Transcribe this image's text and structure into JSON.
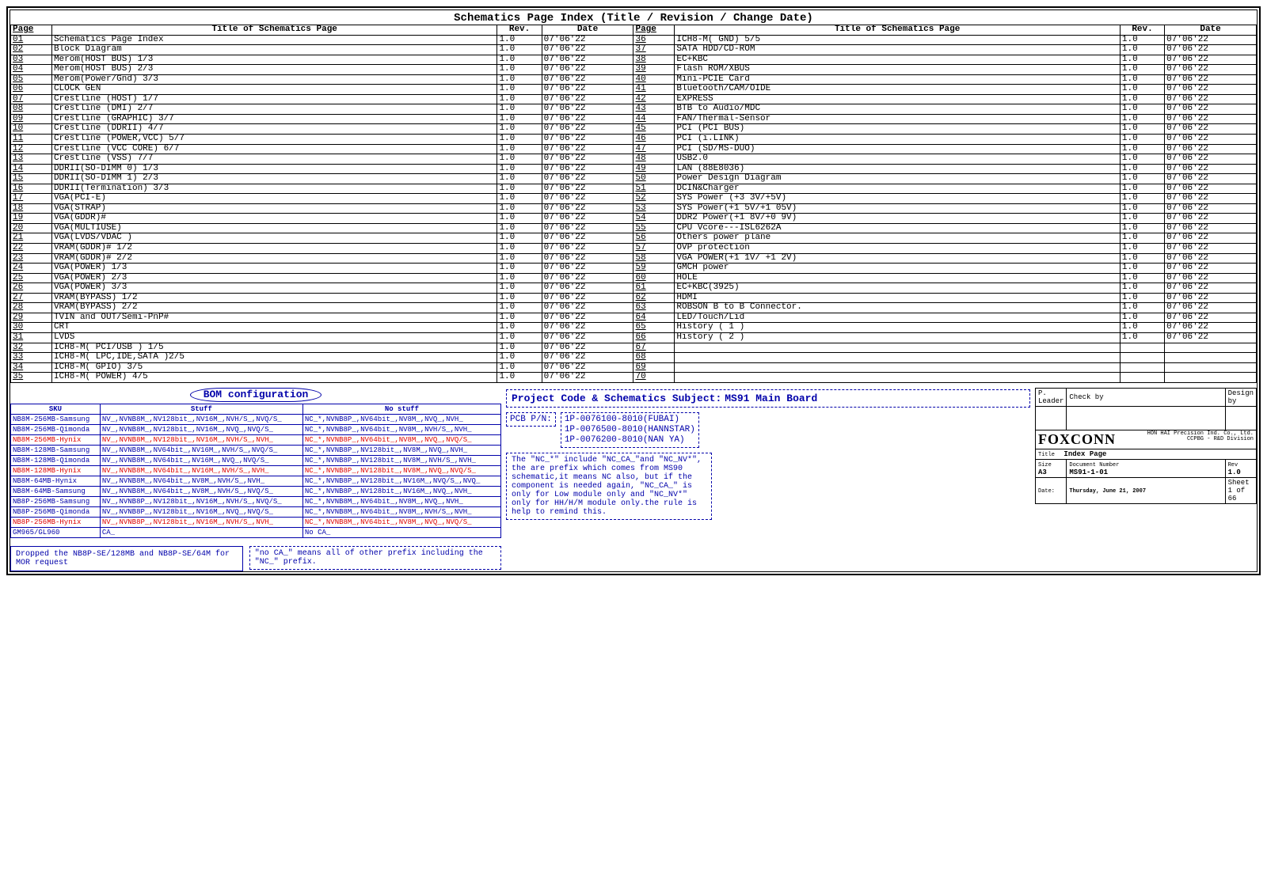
{
  "main_title": "Schematics Page Index (Title / Revision / Change Date)",
  "headers": {
    "page": "Page",
    "title": "Title of Schematics Page",
    "rev": "Rev.",
    "date": "Date"
  },
  "left_rows": [
    {
      "p": "01",
      "t": "Schematics Page Index",
      "r": "1.0",
      "d": "07'06'22"
    },
    {
      "p": "02",
      "t": "Block Diagram",
      "r": "1.0",
      "d": "07'06'22"
    },
    {
      "p": "03",
      "t": "Merom(HOST BUS) 1/3",
      "r": "1.0",
      "d": "07'06'22"
    },
    {
      "p": "04",
      "t": "Merom(HOST BUS) 2/3",
      "r": "1.0",
      "d": "07'06'22"
    },
    {
      "p": "05",
      "t": "Merom(Power/Gnd) 3/3",
      "r": "1.0",
      "d": "07'06'22"
    },
    {
      "p": "06",
      "t": "CLOCK GEN",
      "r": "1.0",
      "d": "07'06'22"
    },
    {
      "p": "07",
      "t": "Crestline (HOST) 1/7",
      "r": "1.0",
      "d": "07'06'22"
    },
    {
      "p": "08",
      "t": "Crestline (DMI) 2/7",
      "r": "1.0",
      "d": "07'06'22"
    },
    {
      "p": "09",
      "t": "Crestline (GRAPHIC) 3/7",
      "r": "1.0",
      "d": "07'06'22"
    },
    {
      "p": "10",
      "t": "Crestline (DDRII) 4/7",
      "r": "1.0",
      "d": "07'06'22"
    },
    {
      "p": "11",
      "t": "Crestline (POWER,VCC) 5/7",
      "r": "1.0",
      "d": "07'06'22"
    },
    {
      "p": "12",
      "t": "Crestline (VCC CORE) 6/7",
      "r": "1.0",
      "d": "07'06'22"
    },
    {
      "p": "13",
      "t": "Crestline (VSS) 7/7",
      "r": "1.0",
      "d": "07'06'22"
    },
    {
      "p": "14",
      "t": "DDRII(SO-DIMM 0) 1/3",
      "r": "1.0",
      "d": "07'06'22"
    },
    {
      "p": "15",
      "t": "DDRII(SO-DIMM 1) 2/3",
      "r": "1.0",
      "d": "07'06'22"
    },
    {
      "p": "16",
      "t": "DDRII(Termination) 3/3",
      "r": "1.0",
      "d": "07'06'22"
    },
    {
      "p": "17",
      "t": "VGA(PCI-E)",
      "r": "1.0",
      "d": "07'06'22"
    },
    {
      "p": "18",
      "t": "VGA(STRAP)",
      "r": "1.0",
      "d": "07'06'22"
    },
    {
      "p": "19",
      "t": "VGA(GDDR)#",
      "r": "1.0",
      "d": "07'06'22"
    },
    {
      "p": "20",
      "t": "VGA(MULTIUSE)",
      "r": "1.0",
      "d": "07'06'22"
    },
    {
      "p": "21",
      "t": "VGA(LVDS/VDAC )",
      "r": "1.0",
      "d": "07'06'22"
    },
    {
      "p": "22",
      "t": "VRAM(GDDR)# 1/2",
      "r": "1.0",
      "d": "07'06'22"
    },
    {
      "p": "23",
      "t": "VRAM(GDDR)# 2/2",
      "r": "1.0",
      "d": "07'06'22"
    },
    {
      "p": "24",
      "t": "VGA(POWER) 1/3",
      "r": "1.0",
      "d": "07'06'22"
    },
    {
      "p": "25",
      "t": "VGA(POWER) 2/3",
      "r": "1.0",
      "d": "07'06'22"
    },
    {
      "p": "26",
      "t": "VGA(POWER) 3/3",
      "r": "1.0",
      "d": "07'06'22"
    },
    {
      "p": "27",
      "t": "VRAM(BYPASS)  1/2",
      "r": "1.0",
      "d": "07'06'22"
    },
    {
      "p": "28",
      "t": "VRAM(BYPASS)  2/2",
      "r": "1.0",
      "d": "07'06'22"
    },
    {
      "p": "29",
      "t": "TVIN and OUT/Semi-PnP#",
      "r": "1.0",
      "d": "07'06'22"
    },
    {
      "p": "30",
      "t": "CRT",
      "r": "1.0",
      "d": "07'06'22"
    },
    {
      "p": "31",
      "t": "LVDS",
      "r": "1.0",
      "d": "07'06'22"
    },
    {
      "p": "32",
      "t": "ICH8-M( PCI/USB ) 1/5",
      "r": "1.0",
      "d": "07'06'22"
    },
    {
      "p": "33",
      "t": "ICH8-M( LPC,IDE,SATA )2/5",
      "r": "1.0",
      "d": "07'06'22"
    },
    {
      "p": "34",
      "t": "ICH8-M( GPIO) 3/5",
      "r": "1.0",
      "d": "07'06'22"
    },
    {
      "p": "35",
      "t": "ICH8-M( POWER) 4/5",
      "r": "1.0",
      "d": "07'06'22"
    }
  ],
  "right_rows": [
    {
      "p": "36",
      "t": "ICH8-M( GND) 5/5",
      "r": "1.0",
      "d": "07'06'22"
    },
    {
      "p": "37",
      "t": "SATA HDD/CD-ROM",
      "r": "1.0",
      "d": "07'06'22"
    },
    {
      "p": "38",
      "t": "EC+KBC",
      "r": "1.0",
      "d": "07'06'22"
    },
    {
      "p": "39",
      "t": "Flash ROM/XBUS",
      "r": "1.0",
      "d": "07'06'22"
    },
    {
      "p": "40",
      "t": "Mini-PCIE Card",
      "r": "1.0",
      "d": "07'06'22"
    },
    {
      "p": "41",
      "t": "Bluetooth/CAM/OIDE",
      "r": "1.0",
      "d": "07'06'22"
    },
    {
      "p": "42",
      "t": "EXPRESS",
      "r": "1.0",
      "d": "07'06'22"
    },
    {
      "p": "43",
      "t": "BTB to Audio/MDC",
      "r": "1.0",
      "d": "07'06'22"
    },
    {
      "p": "44",
      "t": "FAN/Thermal-Sensor",
      "r": "1.0",
      "d": "07'06'22"
    },
    {
      "p": "45",
      "t": "PCI (PCI BUS)",
      "r": "1.0",
      "d": "07'06'22"
    },
    {
      "p": "46",
      "t": "PCI (i.LINK)",
      "r": "1.0",
      "d": "07'06'22"
    },
    {
      "p": "47",
      "t": "PCI (SD/MS-DUO)",
      "r": "1.0",
      "d": "07'06'22"
    },
    {
      "p": "48",
      "t": "USB2.0",
      "r": "1.0",
      "d": "07'06'22"
    },
    {
      "p": "49",
      "t": "LAN (88E8036)",
      "r": "1.0",
      "d": "07'06'22"
    },
    {
      "p": "50",
      "t": "Power Design Diagram",
      "r": "1.0",
      "d": "07'06'22"
    },
    {
      "p": "51",
      "t": "DCIN&Charger",
      "r": "1.0",
      "d": "07'06'22"
    },
    {
      "p": "52",
      "t": "SYS Power (+3 3V/+5V)",
      "r": "1.0",
      "d": "07'06'22"
    },
    {
      "p": "53",
      "t": "SYS Power(+1 5V/+1 05V)",
      "r": "1.0",
      "d": "07'06'22"
    },
    {
      "p": "54",
      "t": "DDR2 Power(+1 8V/+0 9V)",
      "r": "1.0",
      "d": "07'06'22"
    },
    {
      "p": "55",
      "t": "CPU Vcore---ISL6262A",
      "r": "1.0",
      "d": "07'06'22"
    },
    {
      "p": "56",
      "t": "Others power plane",
      "r": "1.0",
      "d": "07'06'22"
    },
    {
      "p": "57",
      "t": "OVP protection",
      "r": "1.0",
      "d": "07'06'22"
    },
    {
      "p": "58",
      "t": "VGA POWER(+1 1V/ +1 2V)",
      "r": "1.0",
      "d": "07'06'22"
    },
    {
      "p": "59",
      "t": "GMCH power",
      "r": "1.0",
      "d": "07'06'22"
    },
    {
      "p": "60",
      "t": "HOLE",
      "r": "1.0",
      "d": "07'06'22"
    },
    {
      "p": "61",
      "t": "EC+KBC(3925)",
      "r": "1.0",
      "d": "07'06'22"
    },
    {
      "p": "62",
      "t": "HDMI",
      "r": "1.0",
      "d": "07'06'22"
    },
    {
      "p": "63",
      "t": "ROBSON B to B Connector.",
      "r": "1.0",
      "d": "07'06'22"
    },
    {
      "p": "64",
      "t": "LED/Touch/Lid",
      "r": "1.0",
      "d": "07'06'22"
    },
    {
      "p": "65",
      "t": "History ( 1 )",
      "r": "1.0",
      "d": "07'06'22"
    },
    {
      "p": "66",
      "t": "History ( 2 )",
      "r": "1.0",
      "d": "07'06'22"
    },
    {
      "p": "67",
      "t": "",
      "r": "",
      "d": ""
    },
    {
      "p": "68",
      "t": "",
      "r": "",
      "d": ""
    },
    {
      "p": "69",
      "t": "",
      "r": "",
      "d": ""
    },
    {
      "p": "70",
      "t": "",
      "r": "",
      "d": ""
    }
  ],
  "bom": {
    "title": "BOM configuration",
    "h_sku": "SKU",
    "h_stuff": "Stuff",
    "h_nostuff": "No stuff",
    "rows": [
      {
        "sku": "NB8M-256MB-Samsung",
        "stuff": "NV_,NVNB8M_,NV128bit_,NV16M_,NVH/S_,NVQ/S_",
        "ns": "NC_*,NVNB8P_,NV64bit_,NV8M_,NVQ_,NVH_",
        "red": false
      },
      {
        "sku": "NB8M-256MB-Qimonda",
        "stuff": "NV_,NVNB8M_,NV128bit_,NV16M_,NVQ_,NVQ/S_",
        "ns": "NC_*,NVNB8P_,NV64bit_,NV8M_,NVH/S_,NVH_",
        "red": false
      },
      {
        "sku": "NB8M-256MB-Hynix",
        "stuff": "NV_,NVNB8M_,NV128bit_,NV16M_,NVH/S_,NVH_",
        "ns": "NC_*,NVNB8P_,NV64bit_,NV8M_,NVQ_,NVQ/S_",
        "red": true
      },
      {
        "sku": "NB8M-128MB-Samsung",
        "stuff": "NV_,NVNB8M_,NV64bit_,NV16M_,NVH/S_,NVQ/S_",
        "ns": "NC_*,NVNB8P_,NV128bit_,NV8M_,NVQ_,NVH_",
        "red": false
      },
      {
        "sku": "NB8M-128MB-Qimonda",
        "stuff": "NV_,NVNB8M_,NV64bit_,NV16M_,NVQ_,NVQ/S_",
        "ns": "NC_*,NVNB8P_,NV128bit_,NV8M_,NVH/S_,NVH_",
        "red": false
      },
      {
        "sku": "NB8M-128MB-Hynix",
        "stuff": "NV_,NVNB8M_,NV64bit_,NV16M_,NVH/S_,NVH_",
        "ns": "NC_*,NVNB8P_,NV128bit_,NV8M_,NVQ_,NVQ/S_",
        "red": true
      },
      {
        "sku": "NB8M-64MB-Hynix",
        "stuff": "NV_,NVNB8M_,NV64bit_,NV8M_,NVH/S_,NVH_",
        "ns": "NC_*,NVNB8P_,NV128bit_,NV16M_,NVQ/S_,NVQ_",
        "red": false
      },
      {
        "sku": "NB8M-64MB-Samsung",
        "stuff": "NV_,NVNB8M_,NV64bit_,NV8M_,NVH/S_,NVQ/S_",
        "ns": "NC_*,NVNB8P_,NV128bit_,NV16M_,NVQ_,NVH_",
        "red": false
      },
      {
        "sku": "NB8P-256MB-Samsung",
        "stuff": "NV_,NVNB8P_,NV128bit_,NV16M_,NVH/S_,NVQ/S_",
        "ns": "NC_*,NVNB8M_,NV64bit_,NV8M_,NVQ_,NVH_",
        "red": false
      },
      {
        "sku": "NB8P-256MB-Qimonda",
        "stuff": "NV_,NVNB8P_,NV128bit_,NV16M_,NVQ_,NVQ/S_",
        "ns": "NC_*,NVNB8M_,NV64bit_,NV8M_,NVH/S_,NVH_",
        "red": false
      },
      {
        "sku": "NB8P-256MB-Hynix",
        "stuff": "NV_,NVNB8P_,NV128bit_,NV16M_,NVH/S_,NVH_",
        "ns": "NC_*,NVNB8M_,NV64bit_,NV8M_,NVQ_,NVQ/S_",
        "red": true
      },
      {
        "sku": "GM965/GL960",
        "stuff": "CA_",
        "ns": "No CA_",
        "red": false
      }
    ]
  },
  "drop_note": "Dropped the NB8P-SE/128MB and NB8P-SE/64M for MOR request",
  "no_ca_note": "\"no CA_\" means all of other prefix including the \"NC_\" prefix.",
  "nc_note": "The \"NC_*\" include \"NC_CA_\"and \"NC_NV*\", the are prefix which comes from MS90 schematic,it means NC also, but if the component is needed again, \"NC_CA_\" is only for Low module only and \"NC_NV*\" only for HH/H/M module only.the rule is help to remind this.",
  "project_label": "Project Code & Schematics Subject:",
  "project_value": "MS91 Main Board",
  "pcb_pn_label": "PCB P/N:",
  "pcb_codes": [
    "1P-0076100-8010(FUBAI)",
    "1P-0076500-8010(HANNSTAR)",
    "1P-0076200-8010(NAN YA)"
  ],
  "title_block": {
    "leader": "P. Leader",
    "check": "Check by",
    "design": "Design by",
    "company": "FOXCONN",
    "company_sub1": "HON HAI Precision Ind. Co., Ltd.",
    "company_sub2": "CCPBG - R&D Division",
    "title_lbl": "Title",
    "title_val": "Index Page",
    "size_lbl": "Size",
    "size_val": "A3",
    "doc_lbl": "Document Number",
    "doc_val": "MS91-1-01",
    "rev_lbl": "Rev",
    "rev_val": "1.0",
    "date_lbl": "Date:",
    "date_val": "Thursday, June 21, 2007",
    "sheet_lbl": "Sheet",
    "sheet_cur": "1",
    "sheet_of": "of",
    "sheet_tot": "66"
  }
}
